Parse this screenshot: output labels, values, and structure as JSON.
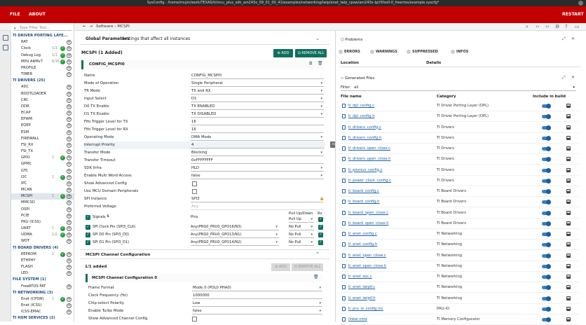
{
  "window": {
    "title": "SysConfig - /home/mujin/work/TEXAS/ti/mcu_plus_sdk_am243x_09_01_00_41/examples/networking/lwip/enet_lwip_cpsw/am243x-lp/r5fss0-0_freertos/example.syscfg*"
  },
  "menu": {
    "file": "FILE",
    "about": "ABOUT",
    "restart": "RESTART"
  },
  "tree": {
    "filter_placeholder": "Type Filter Text...",
    "rows": [
      {
        "type": "header",
        "label": "TI DRIVER PORTING LAYE..."
      },
      {
        "type": "item",
        "label": "RAT",
        "count": "",
        "ok": false
      },
      {
        "type": "item",
        "label": "Clock",
        "count": "1/1",
        "ok": true
      },
      {
        "type": "item",
        "label": "Debug Log",
        "count": "1/1",
        "ok": true
      },
      {
        "type": "item",
        "label": "MPU ARMv7",
        "count": "6/16",
        "ok": true
      },
      {
        "type": "item",
        "label": "PROFILE",
        "count": "",
        "ok": false
      },
      {
        "type": "item",
        "label": "TIMER",
        "count": "",
        "ok": false
      },
      {
        "type": "header",
        "label": "TI DRIVERS (25)"
      },
      {
        "type": "item",
        "label": "ADC",
        "count": "",
        "ok": false
      },
      {
        "type": "item",
        "label": "BOOTLOADER",
        "count": "",
        "ok": false
      },
      {
        "type": "item",
        "label": "CRC",
        "count": "",
        "ok": false
      },
      {
        "type": "item",
        "label": "DDR",
        "count": "",
        "ok": false
      },
      {
        "type": "item",
        "label": "ECAP",
        "count": "",
        "ok": false
      },
      {
        "type": "item",
        "label": "EPWM",
        "count": "",
        "ok": false
      },
      {
        "type": "item",
        "label": "EQEP",
        "count": "",
        "ok": false
      },
      {
        "type": "item",
        "label": "ESM",
        "count": "",
        "ok": false
      },
      {
        "type": "item",
        "label": "FIREWALL",
        "count": "",
        "ok": false
      },
      {
        "type": "item",
        "label": "FSI_RX",
        "count": "",
        "ok": false
      },
      {
        "type": "item",
        "label": "FSI_TX",
        "count": "",
        "ok": false
      },
      {
        "type": "item",
        "label": "GPIO",
        "count": "2",
        "ok": true
      },
      {
        "type": "item",
        "label": "GPMC",
        "count": "",
        "ok": false
      },
      {
        "type": "item",
        "label": "GTC",
        "count": "",
        "ok": false
      },
      {
        "type": "item",
        "label": "I2C",
        "count": "1",
        "ok": true
      },
      {
        "type": "item",
        "label": "IPC",
        "count": "",
        "ok": false
      },
      {
        "type": "item",
        "label": "MCAN",
        "count": "",
        "ok": false
      },
      {
        "type": "item",
        "label": "MCSPI",
        "count": "1",
        "ok": true,
        "selected": true
      },
      {
        "type": "item",
        "label": "MMCSD",
        "count": "",
        "ok": false
      },
      {
        "type": "item",
        "label": "OSPI",
        "count": "",
        "ok": false
      },
      {
        "type": "item",
        "label": "PCIE",
        "count": "",
        "ok": false
      },
      {
        "type": "item",
        "label": "PRU (ICSS)",
        "count": "",
        "ok": false
      },
      {
        "type": "item",
        "label": "UART",
        "count": "1",
        "ok": true
      },
      {
        "type": "item",
        "label": "UDMA",
        "count": "1/2",
        "ok": true
      },
      {
        "type": "item",
        "label": "WDT",
        "count": "",
        "ok": false
      },
      {
        "type": "header",
        "label": "TI BOARD DRIVERS (4)"
      },
      {
        "type": "item",
        "label": "EEPROM",
        "count": "1",
        "ok": true
      },
      {
        "type": "item",
        "label": "ETHPHY",
        "count": "",
        "ok": false
      },
      {
        "type": "item",
        "label": "FLASH",
        "count": "",
        "ok": false
      },
      {
        "type": "item",
        "label": "LED",
        "count": "",
        "ok": false
      },
      {
        "type": "header",
        "label": "FILE SYSTEM (1)"
      },
      {
        "type": "item",
        "label": "FreeRTOS FAT",
        "count": "",
        "ok": false
      },
      {
        "type": "header",
        "label": "TI NETWORKING (3)"
      },
      {
        "type": "item",
        "label": "Enet (CPSW)",
        "count": "1",
        "ok": true
      },
      {
        "type": "item",
        "label": "Enet (ICSS)",
        "count": "",
        "ok": false
      },
      {
        "type": "item",
        "label": "ICSS-EMAC",
        "count": "",
        "ok": false
      },
      {
        "type": "header",
        "label": "TI HSM SERVICES (2)"
      }
    ]
  },
  "breadcrumb": {
    "root": "Software",
    "current": "MCSPI"
  },
  "global": {
    "title": "Global Parameters",
    "subtitle": "Settings that affect all instances"
  },
  "module": {
    "title": "MCSPI (1 Added)",
    "add": "ADD",
    "remove_all": "REMOVE ALL",
    "instance": "CONFIG_MCSPI0"
  },
  "params": [
    {
      "k": "Name",
      "v": "CONFIG_MCSPI0",
      "kind": "text"
    },
    {
      "k": "Mode of Operation",
      "v": "Single Peripheral",
      "kind": "dd"
    },
    {
      "k": "TR Mode",
      "v": "TX and RX",
      "kind": "dd"
    },
    {
      "k": "Input Select",
      "v": "D1",
      "kind": "dd"
    },
    {
      "k": "D0 TX Enable",
      "v": "TX ENABLED",
      "kind": "dd"
    },
    {
      "k": "D1 TX Enable",
      "v": "TX DISABLED",
      "kind": "dd"
    },
    {
      "k": "Fifo Trigger Level for TX",
      "v": "16",
      "kind": "text"
    },
    {
      "k": "Fifo Trigger Level for RX",
      "v": "16",
      "kind": "text"
    },
    {
      "k": "Operating Mode",
      "v": "DMA Mode",
      "kind": "dd"
    },
    {
      "k": "Interrupt Priority",
      "v": "4",
      "kind": "text",
      "hl": true
    },
    {
      "k": "Transfer Mode",
      "v": "Blocking",
      "kind": "dd"
    },
    {
      "k": "Transfer Timeout",
      "v": "0xFFFFFFFF",
      "kind": "text"
    },
    {
      "k": "SDK Infra",
      "v": "HLD",
      "kind": "dd"
    },
    {
      "k": "Enable Multi Word Access",
      "v": "false",
      "kind": "dd"
    },
    {
      "k": "Show Advanced Config",
      "v": "",
      "kind": "cb"
    },
    {
      "k": "Use MCU Domain Peripherals",
      "v": "",
      "kind": "cb"
    },
    {
      "k": "SPI Instance",
      "v": "SPI3",
      "kind": "lock"
    },
    {
      "k": "Preferred Voltage",
      "v": "Any",
      "kind": "dis"
    }
  ],
  "signals": {
    "title": "Signals",
    "pins_header": "Pins",
    "pull_header": "Pull Up/Down",
    "rx_header": "Rx",
    "pull_top_value": "Pull Up",
    "rows": [
      {
        "name": "SPI Clock Pin (SPI3_CLK)",
        "pin": "Any(PRG0_PRU0_GPO16/N3)",
        "pull": "No Pull"
      },
      {
        "name": "SPI D0 Pin (SPI3_D0)",
        "pin": "Any(PRG0_PRU0_GPO13/N1)",
        "pull": "No Pull"
      },
      {
        "name": "SPI D1 Pin (SPI3_D1)",
        "pin": "Any(PRG0_PRU0_GPO14/N2)",
        "pull": "No Pull"
      }
    ]
  },
  "channel": {
    "section_title": "MCSPI Channel Configuration",
    "added": "1/1 added",
    "add": "ADD",
    "remove_all": "REMOVE ALL",
    "instance": "MCSPI Channel Configuration 0",
    "params": [
      {
        "k": "Frame Format",
        "v": "Mode 0 (POL0 PHA0)",
        "kind": "dd"
      },
      {
        "k": "Clock Frequency (Hz)",
        "v": "1000000",
        "kind": "text"
      },
      {
        "k": "Chip-select Polarity",
        "v": "Low",
        "kind": "dd"
      },
      {
        "k": "Enable Turbo Mode",
        "v": "false",
        "kind": "dd"
      },
      {
        "k": "Show Advanced Channel Config",
        "v": "",
        "kind": "cb"
      }
    ]
  },
  "tooltip": "Interrupt Priority: 0 (highest) to 15 (lowest)",
  "problems": {
    "title": "Problems",
    "chips": [
      "ERRORS",
      "WARNINGS",
      "SUPPRESSED",
      "INFOS"
    ],
    "col_location": "Location",
    "col_details": "Details"
  },
  "generated": {
    "title": "Generated Files",
    "filter_label": "Filter:",
    "filter_value": "all",
    "col_file": "File name",
    "col_category": "Category",
    "col_include": "Include in build",
    "files": [
      {
        "name": "ti_dpl_config.c",
        "cat": "TI Driver Porting Layer (DPL)"
      },
      {
        "name": "ti_dpl_config.h",
        "cat": "TI Driver Porting Layer (DPL)"
      },
      {
        "name": "ti_drivers_config.c",
        "cat": "TI Drivers"
      },
      {
        "name": "ti_drivers_config.h",
        "cat": "TI Drivers"
      },
      {
        "name": "ti_drivers_open_close.c",
        "cat": "TI Drivers"
      },
      {
        "name": "ti_drivers_open_close.h",
        "cat": "TI Drivers"
      },
      {
        "name": "ti_pinmux_config.c",
        "cat": "TI Drivers"
      },
      {
        "name": "ti_power_clock_config.c",
        "cat": "TI Drivers"
      },
      {
        "name": "ti_board_config.c",
        "cat": "TI Board Drivers"
      },
      {
        "name": "ti_board_config.h",
        "cat": "TI Board Drivers"
      },
      {
        "name": "ti_board_open_close.c",
        "cat": "TI Board Drivers"
      },
      {
        "name": "ti_board_open_close.h",
        "cat": "TI Board Drivers"
      },
      {
        "name": "ti_enet_config.c",
        "cat": "TI Networking"
      },
      {
        "name": "ti_enet_config.h",
        "cat": "TI Networking"
      },
      {
        "name": "ti_enet_open_close.c",
        "cat": "TI Networking"
      },
      {
        "name": "ti_enet_open_close.h",
        "cat": "TI Networking"
      },
      {
        "name": "ti_enet_soc.c",
        "cat": "TI Networking"
      },
      {
        "name": "ti_enet_lwipif.c",
        "cat": "TI Networking"
      },
      {
        "name": "ti_enet_lwipif.h",
        "cat": "TI Networking"
      },
      {
        "name": "ti_pru_io_config.inc",
        "cat": "PRU-IO"
      },
      {
        "name": "linker.cmd",
        "cat": "TI Memory Configurator"
      }
    ]
  },
  "colors": {
    "brand_red": "#c30000",
    "accent_teal": "#107060",
    "link_blue": "#1b5fa8"
  }
}
